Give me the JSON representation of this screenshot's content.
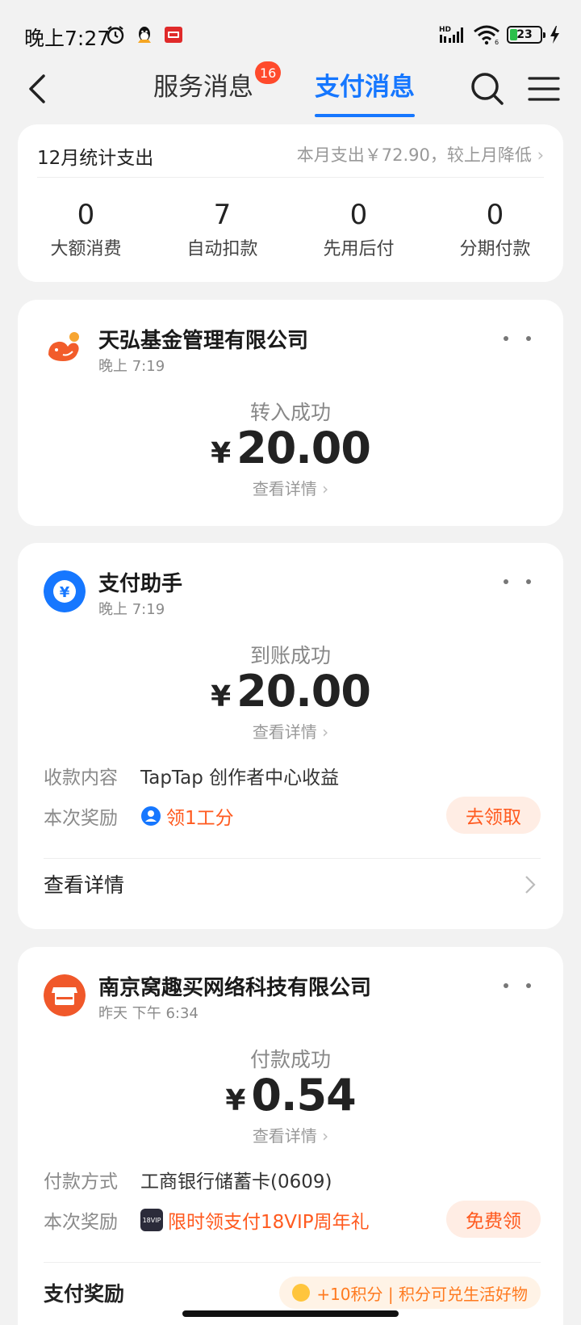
{
  "status_bar": {
    "time": "晚上7:27",
    "battery": "23",
    "icons": [
      "alarm-icon",
      "qq-icon",
      "app-notification-icon",
      "hd-signal-icon",
      "wifi-icon",
      "battery-icon",
      "charging-icon"
    ]
  },
  "header": {
    "tabs": [
      {
        "label": "服务消息",
        "badge": "16"
      },
      {
        "label": "支付消息"
      }
    ],
    "accent": "#1677ff"
  },
  "summary": {
    "title": "12月统计支出",
    "hint": "本月支出￥72.90，较上月降低",
    "stats": [
      {
        "value": "0",
        "label": "大额消费"
      },
      {
        "value": "7",
        "label": "自动扣款"
      },
      {
        "value": "0",
        "label": "先用后付"
      },
      {
        "value": "0",
        "label": "分期付款"
      }
    ]
  },
  "messages": [
    {
      "merchant": "天弘基金管理有限公司",
      "time": "晚上 7:19",
      "status": "转入成功",
      "currency": "¥",
      "amount": "20.00",
      "detail_link": "查看详情"
    },
    {
      "merchant": "支付助手",
      "time": "晚上 7:19",
      "status": "到账成功",
      "currency": "¥",
      "amount": "20.00",
      "detail_link": "查看详情",
      "rows": [
        {
          "key": "收款内容",
          "value": "TapTap 创作者中心收益"
        },
        {
          "key": "本次奖励",
          "value": "领1工分",
          "action": "去领取"
        }
      ],
      "footer": "查看详情"
    },
    {
      "merchant": "南京窝趣买网络科技有限公司",
      "time": "昨天 下午 6:34",
      "status": "付款成功",
      "currency": "¥",
      "amount": "0.54",
      "detail_link": "查看详情",
      "rows": [
        {
          "key": "付款方式",
          "value": "工商银行储蓄卡(0609)"
        },
        {
          "key": "本次奖励",
          "value": "限时领支付18VIP周年礼",
          "action": "免费领",
          "icon_text": "18VIP"
        }
      ],
      "footer": "支付奖励",
      "footer_hint": "+10积分 | 积分可兑生活好物"
    }
  ]
}
